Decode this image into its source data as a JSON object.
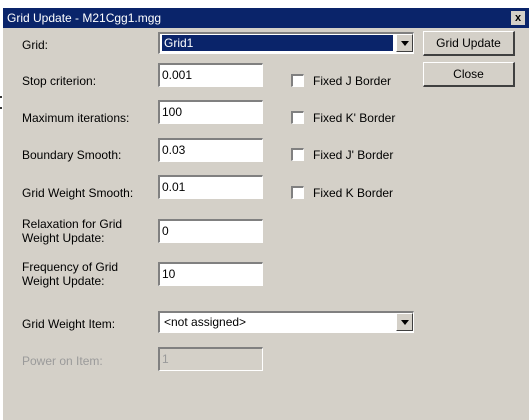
{
  "window": {
    "title": "Grid Update - M21Cgg1.mgg",
    "close_glyph": "x"
  },
  "grid": {
    "label": "Grid:",
    "value": "Grid1"
  },
  "buttons": {
    "grid_update": "Grid Update",
    "close": "Close"
  },
  "fields": {
    "stop_criterion": {
      "label": "Stop criterion:",
      "value": "0.001"
    },
    "max_iterations": {
      "label": "Maximum iterations:",
      "value": "100"
    },
    "boundary_smooth": {
      "label": "Boundary Smooth:",
      "value": "0.03"
    },
    "grid_weight_smooth": {
      "label": "Grid Weight Smooth:",
      "value": "0.01"
    },
    "relaxation": {
      "label_line1": "Relaxation for Grid",
      "label_line2": "Weight Update:",
      "value": "0"
    },
    "frequency": {
      "label_line1": "Frequency of Grid",
      "label_line2": "Weight Update:",
      "value": "10"
    },
    "power_on_item": {
      "label": "Power on Item:",
      "value": "1"
    }
  },
  "grid_weight_item": {
    "label": "Grid Weight Item:",
    "value": "<not assigned>"
  },
  "checkboxes": [
    {
      "label": "Fixed J Border",
      "checked": false
    },
    {
      "label": "Fixed K' Border",
      "checked": false
    },
    {
      "label": "Fixed J' Border",
      "checked": false
    },
    {
      "label": "Fixed K Border",
      "checked": false
    }
  ]
}
